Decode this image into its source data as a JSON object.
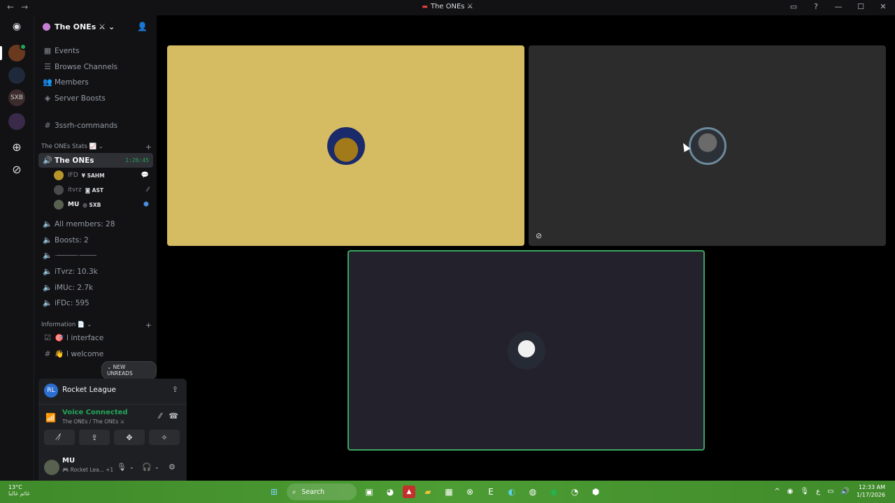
{
  "window": {
    "title": "The ONEs ⚔",
    "nav_back": "←",
    "nav_forward": "→",
    "controls": [
      "▭",
      "?",
      "—",
      "☐",
      "✕"
    ]
  },
  "server": {
    "name": "The ONEs ⚔",
    "chevron": "⌄"
  },
  "sidebar": {
    "top_items": [
      {
        "icon": "▦",
        "label": "Events"
      },
      {
        "icon": "☰",
        "label": "Browse Channels"
      },
      {
        "icon": "👥",
        "label": "Members"
      },
      {
        "icon": "◈",
        "label": "Server Boosts"
      }
    ],
    "text_channel": {
      "icon": "#",
      "label": "3ssrh-commands"
    },
    "category_stats": {
      "label": "The ONEs Stats 📈 ⌄",
      "plus": "+"
    },
    "active_voice": {
      "label": "The ONEs",
      "time": "1:26:45"
    },
    "voice_users": [
      {
        "name": "IFD",
        "tag": "¥ SAHM",
        "right_icon": "💬"
      },
      {
        "name": "itvrz",
        "tag": "◙ AST",
        "right_icon": "⁄⁄"
      },
      {
        "name": "MU",
        "tag": "◎ SXB",
        "right_icon": "⬢"
      }
    ],
    "stat_channels": [
      "All members: 28",
      "Boosts: 2",
      "· ───────── ·  ·───────",
      "iTvrz: 10.3k",
      "iMUc: 2.7k",
      "iFDc: 595"
    ],
    "category_info": {
      "label": "Information 📄 ⌄",
      "plus": "+"
    },
    "info_channels": [
      {
        "icon": "☑",
        "emoji": "🎯",
        "label": "l interface"
      },
      {
        "icon": "#",
        "emoji": "👋",
        "label": "l welcome"
      }
    ],
    "new_unreads": "⌄ NEW UNREADS"
  },
  "activity": {
    "game": "Rocket League",
    "icon": "RL"
  },
  "voice_panel": {
    "status": "Voice Connected",
    "location": "The ONEs / The ONEs ⚔",
    "buttons": [
      "⧸̸",
      "⇪",
      "✥",
      "✧"
    ]
  },
  "user": {
    "name": "MU",
    "status": "🎮 Rocket Lea... +1"
  },
  "taskbar": {
    "temp": "13°C",
    "weather_desc": "غائم غالبا",
    "search": "Search",
    "time": "12:33 AM",
    "date": "1/17/2026",
    "lang": "ع"
  },
  "colors": {
    "tile1": "#d5bb62",
    "tile2": "#2c2c2c",
    "tile3": "#22212c",
    "speaking_border": "#3ba55d",
    "accent_green": "#23a55a"
  }
}
